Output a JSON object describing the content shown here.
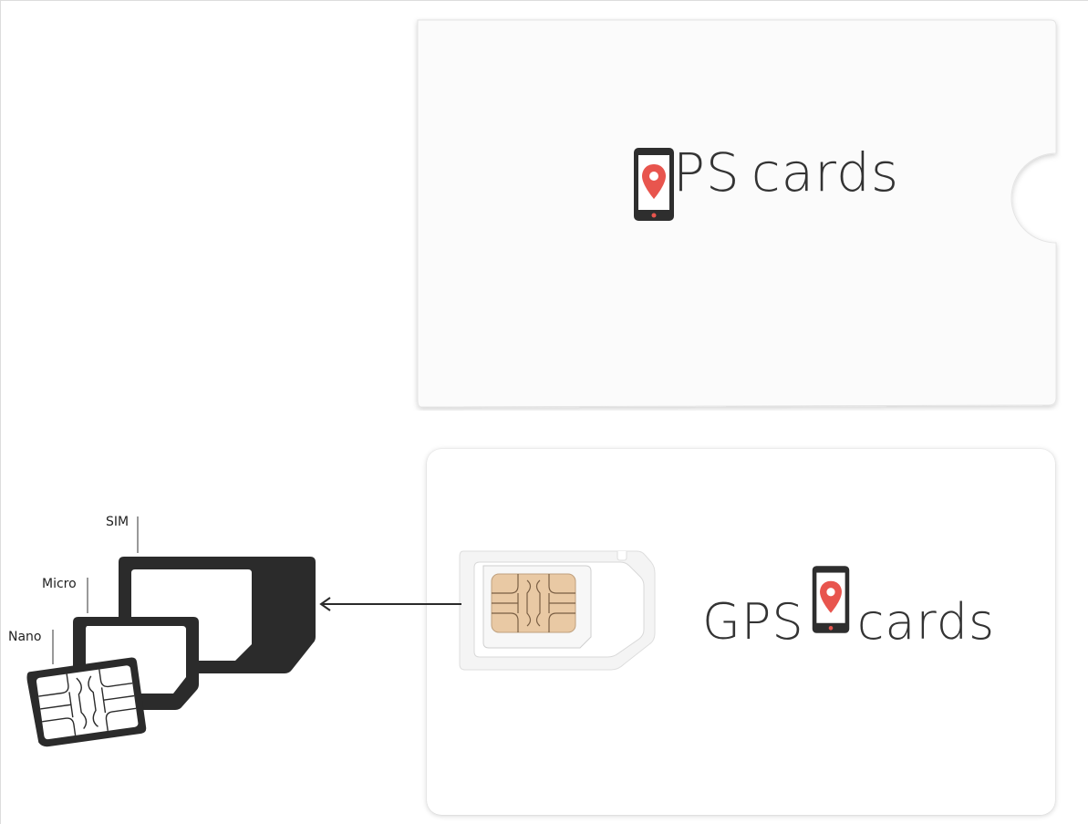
{
  "sleeve": {
    "logo": {
      "left_word": "GPS",
      "right_word": "cards"
    }
  },
  "card": {
    "logo": {
      "left_word": "GPS",
      "right_word": "cards"
    }
  },
  "sim_sizes": {
    "labels": [
      "SIM",
      "Micro",
      "Nano"
    ]
  },
  "colors": {
    "logo_text": "#333333",
    "pin_red": "#e8554e",
    "chip_gold": "#e9c9a4",
    "sim_frame": "#2b2b2b"
  },
  "icons": [
    "phone-location-icon",
    "sim-chip-icon",
    "arrow-left-icon"
  ]
}
